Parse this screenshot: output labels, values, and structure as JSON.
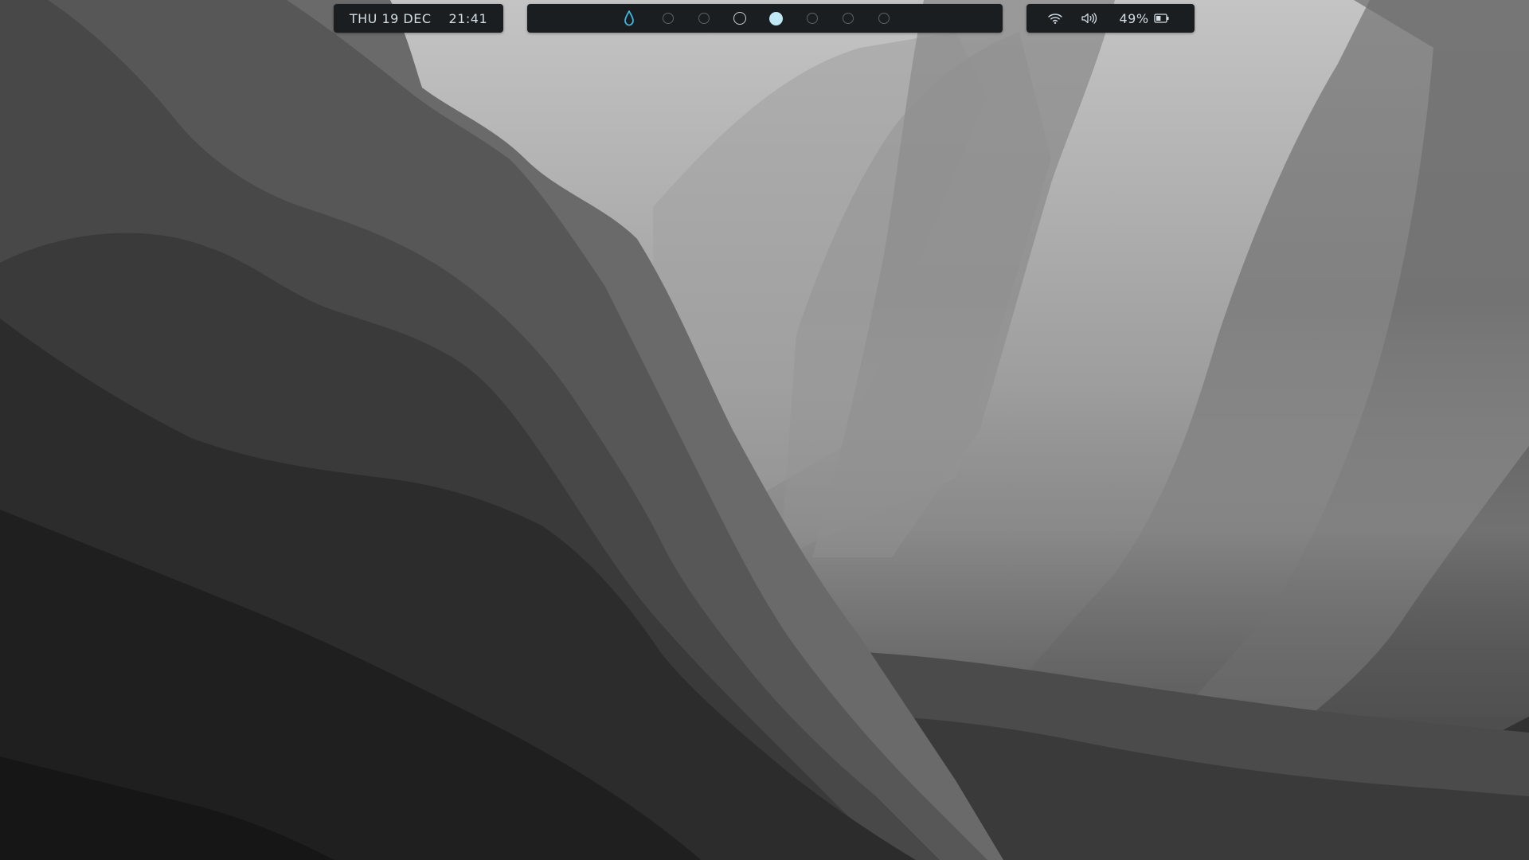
{
  "wallpaper": {
    "description_colors": [
      "#bdbdbd",
      "#9a9a9a",
      "#6e6e6e",
      "#4a4a4a",
      "#2e2e2e",
      "#1a1a1a"
    ]
  },
  "clock": {
    "date": "THU 19 DEC",
    "time": "21:41"
  },
  "workspaces": {
    "logo_icon": "water-drop-icon",
    "accent": "#3fb6e0",
    "items": [
      {
        "state": "empty"
      },
      {
        "state": "empty"
      },
      {
        "state": "occupied"
      },
      {
        "state": "active"
      },
      {
        "state": "empty"
      },
      {
        "state": "empty"
      },
      {
        "state": "empty"
      }
    ]
  },
  "status": {
    "wifi_icon": "wifi-icon",
    "volume_icon": "volume-icon",
    "battery_percent": "49%",
    "battery_icon": "battery-icon",
    "battery_level": 0.49
  },
  "colors": {
    "bar_bg": "#1b1e21",
    "text": "#d3dde3",
    "active_workspace": "#bfe9f4"
  }
}
